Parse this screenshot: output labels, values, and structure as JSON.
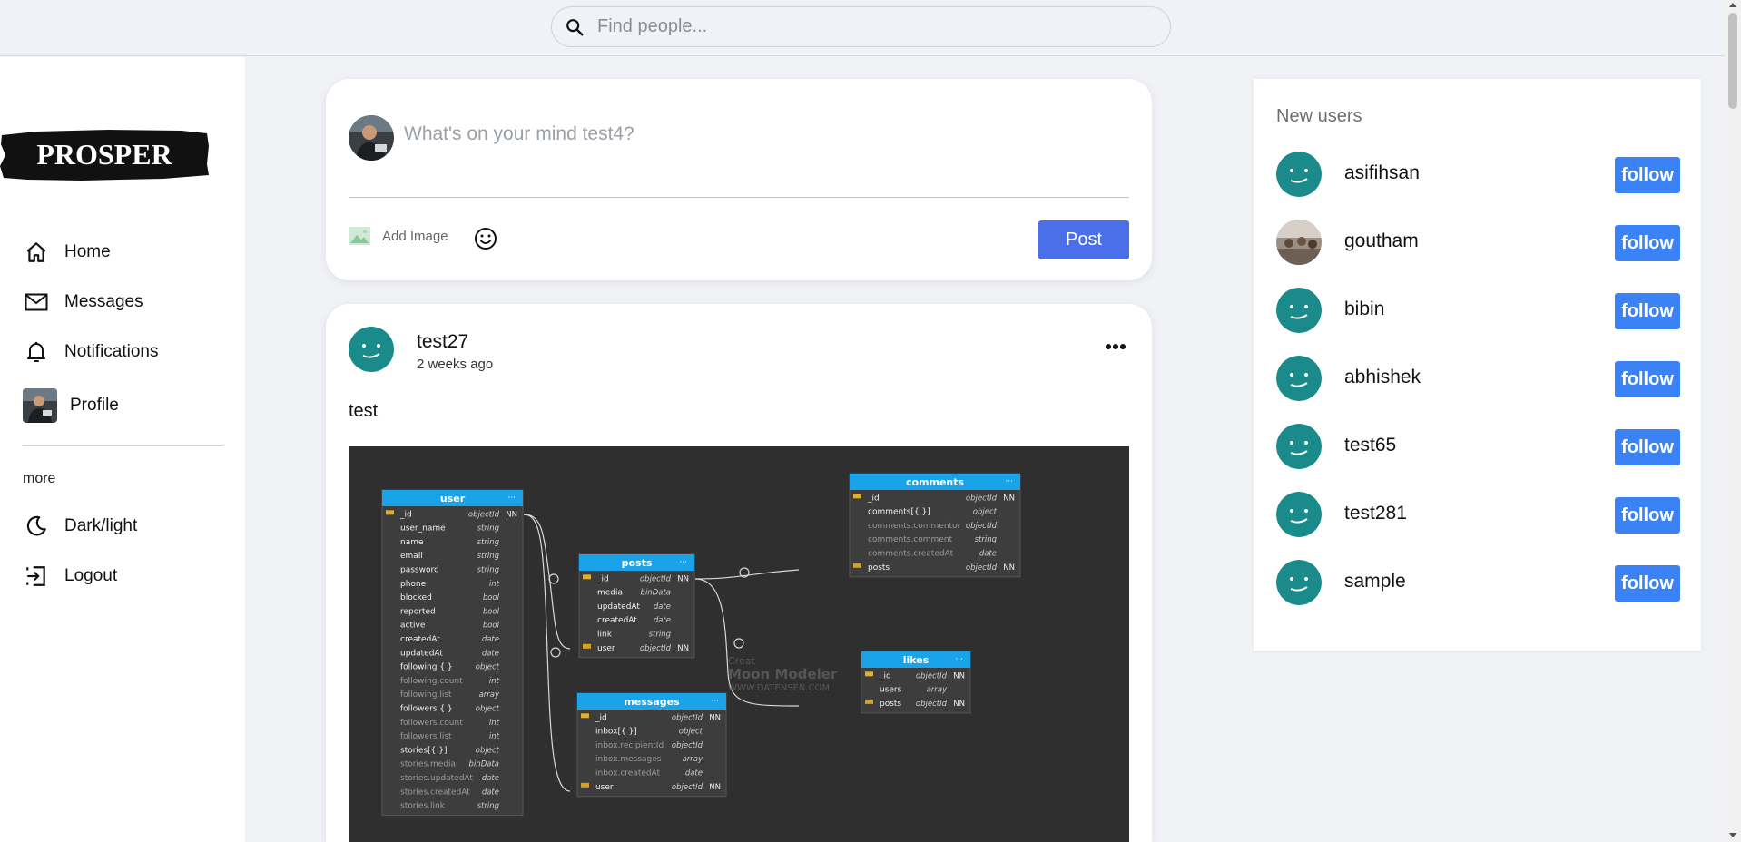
{
  "search": {
    "placeholder": "Find people..."
  },
  "brand": {
    "logo_text": "PROSPER"
  },
  "sidebar": {
    "items": [
      {
        "label": "Home",
        "icon": "home-icon"
      },
      {
        "label": "Messages",
        "icon": "mail-icon"
      },
      {
        "label": "Notifications",
        "icon": "bell-icon"
      },
      {
        "label": "Profile",
        "icon": "avatar"
      }
    ],
    "more_label": "more",
    "more_items": [
      {
        "label": "Dark/light",
        "icon": "moon-icon"
      },
      {
        "label": "Logout",
        "icon": "logout-icon"
      }
    ]
  },
  "composer": {
    "placeholder": "What's on your mind test4?",
    "add_image_label": "Add Image",
    "post_label": "Post"
  },
  "post": {
    "username": "test27",
    "time": "2 weeks ago",
    "text": "test",
    "diagram": {
      "tables": [
        {
          "name": "user",
          "fields": [
            [
              "_id",
              "objectId",
              "NN"
            ],
            [
              "user_name",
              "string",
              ""
            ],
            [
              "name",
              "string",
              ""
            ],
            [
              "email",
              "string",
              ""
            ],
            [
              "password",
              "string",
              ""
            ],
            [
              "phone",
              "int",
              ""
            ],
            [
              "blocked",
              "bool",
              ""
            ],
            [
              "reported",
              "bool",
              ""
            ],
            [
              "active",
              "bool",
              ""
            ],
            [
              "createdAt",
              "date",
              ""
            ],
            [
              "updatedAt",
              "date",
              ""
            ],
            [
              "following { }",
              "object",
              ""
            ],
            [
              "following.count",
              "int",
              ""
            ],
            [
              "following.list",
              "array",
              ""
            ],
            [
              "followers { }",
              "object",
              ""
            ],
            [
              "followers.count",
              "int",
              ""
            ],
            [
              "followers.list",
              "int",
              ""
            ],
            [
              "stories[{ }]",
              "object",
              ""
            ],
            [
              "stories.media",
              "binData",
              ""
            ],
            [
              "stories.updatedAt",
              "date",
              ""
            ],
            [
              "stories.createdAt",
              "date",
              ""
            ],
            [
              "stories.link",
              "string",
              ""
            ]
          ]
        },
        {
          "name": "posts",
          "fields": [
            [
              "_id",
              "objectId",
              "NN"
            ],
            [
              "media",
              "binData",
              ""
            ],
            [
              "updatedAt",
              "date",
              ""
            ],
            [
              "createdAt",
              "date",
              ""
            ],
            [
              "link",
              "string",
              ""
            ],
            [
              "user",
              "objectId",
              "NN"
            ]
          ]
        },
        {
          "name": "comments",
          "fields": [
            [
              "_id",
              "objectId",
              "NN"
            ],
            [
              "comments[{ }]",
              "object",
              ""
            ],
            [
              "comments.commentor",
              "objectId",
              ""
            ],
            [
              "comments.comment",
              "string",
              ""
            ],
            [
              "comments.createdAt",
              "date",
              ""
            ],
            [
              "posts",
              "objectId",
              "NN"
            ]
          ]
        },
        {
          "name": "likes",
          "fields": [
            [
              "_id",
              "objectId",
              "NN"
            ],
            [
              "users",
              "array",
              ""
            ],
            [
              "posts",
              "objectId",
              "NN"
            ]
          ]
        },
        {
          "name": "messages",
          "fields": [
            [
              "_id",
              "objectId",
              "NN"
            ],
            [
              "inbox[{ }]",
              "object",
              ""
            ],
            [
              "inbox.recipientId",
              "objectId",
              ""
            ],
            [
              "inbox.messages",
              "array",
              ""
            ],
            [
              "inbox.createdAt",
              "date",
              ""
            ],
            [
              "user",
              "objectId",
              "NN"
            ]
          ]
        }
      ],
      "watermark_line1": "Creat",
      "watermark_line2": "Moon Modeler",
      "watermark_line3": "WWW.DATENSEN.COM"
    }
  },
  "new_users": {
    "title": "New users",
    "follow_label": "follow",
    "users": [
      {
        "name": "asifihsan",
        "avatar": "smiley"
      },
      {
        "name": "goutham",
        "avatar": "photo"
      },
      {
        "name": "bibin",
        "avatar": "smiley"
      },
      {
        "name": "abhishek",
        "avatar": "smiley"
      },
      {
        "name": "test65",
        "avatar": "smiley"
      },
      {
        "name": "test281",
        "avatar": "smiley"
      },
      {
        "name": "sample",
        "avatar": "smiley"
      }
    ]
  },
  "colors": {
    "accent_blue": "#4a6fe8",
    "follow_blue": "#3b82f6",
    "avatar_teal": "#1a8a8a",
    "table_header": "#1aa3e8"
  }
}
